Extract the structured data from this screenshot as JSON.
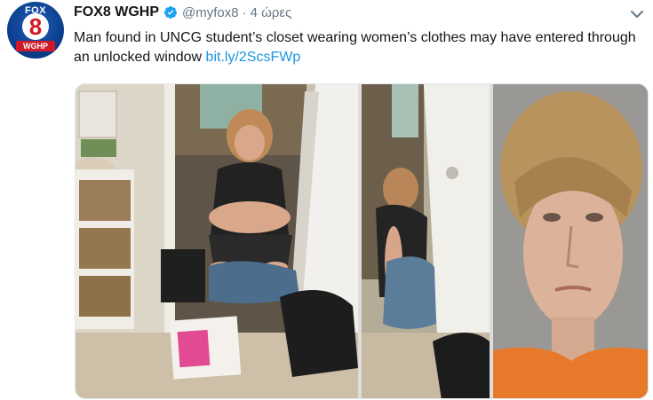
{
  "tweet": {
    "avatar": {
      "logo_top": "FOX",
      "logo_number": "8",
      "logo_call": "WGHP"
    },
    "author_name": "FOX8 WGHP",
    "handle": "@myfox8",
    "separator": "·",
    "time": "4 ώρες",
    "text": "Man found in UNCG student’s closet wearing women’s clothes may have entered through an unlocked window ",
    "link": "bit.ly/2ScsFWp",
    "colors": {
      "link": "#1b95e0",
      "verified": "#1da1f2",
      "secondary_text": "#657786"
    },
    "icons": [
      "verified-badge-icon",
      "chevron-down-icon"
    ]
  }
}
